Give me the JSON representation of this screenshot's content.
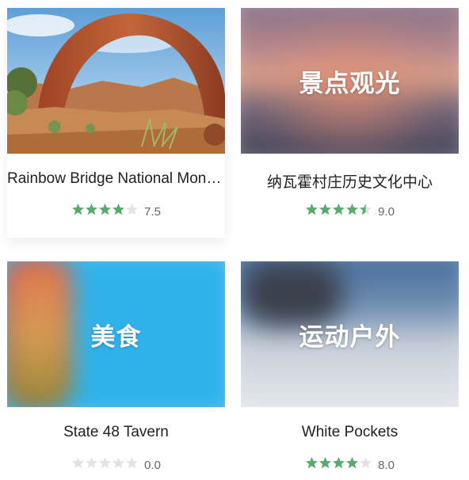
{
  "cards": [
    {
      "title": "Rainbow Bridge National Monument",
      "overlay": "",
      "rating": 7.5,
      "score_text": "7.5",
      "stars_filled": 4,
      "colors": {
        "sky": "#7fb8e6",
        "rock": "#b1562e",
        "ground": "#c98a52",
        "shrub": "#5f7a3a"
      }
    },
    {
      "title": "纳瓦霍村庄历史文化中心",
      "overlay": "景点观光",
      "rating": 9.0,
      "score_text": "9.0",
      "stars_filled": 4.5,
      "colors": {
        "top": "#8a7286",
        "mid": "#e0a48a",
        "bottom": "#3b3e52"
      }
    },
    {
      "title": "State 48 Tavern",
      "overlay": "美食",
      "rating": 0.0,
      "score_text": "0.0",
      "stars_filled": 0,
      "colors": {
        "bg": "#33b4ec",
        "drink1": "#c94b63",
        "drink2": "#d68a4f"
      }
    },
    {
      "title": "White Pockets",
      "overlay": "运动户外",
      "rating": 8.0,
      "score_text": "8.0",
      "stars_filled": 4,
      "colors": {
        "sky": "#4a6f9d",
        "rock": "#dfe3ea",
        "dark": "#3a3f4a"
      }
    }
  ],
  "star_colors": {
    "filled": "#5aaa6e",
    "empty": "#e3e3e3"
  }
}
